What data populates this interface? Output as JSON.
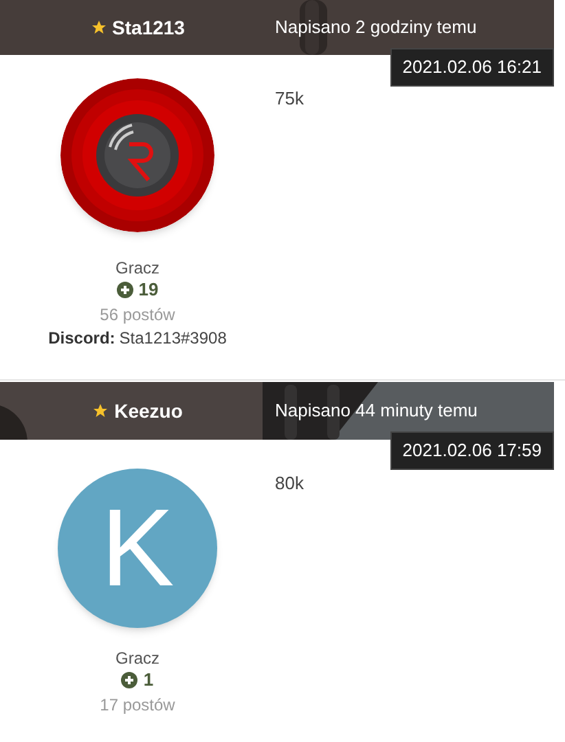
{
  "posts": [
    {
      "author": {
        "name": "Sta1213",
        "starred": true
      },
      "posted": "Napisano 2 godziny temu",
      "timestamp": "2021.02.06 16:21",
      "content": "75k",
      "avatar": {
        "kind": "picture"
      },
      "rank": "Gracz",
      "reputation": "19",
      "post_count": "56 postów",
      "fields": [
        {
          "label": "Discord:",
          "value": "Sta1213#3908"
        }
      ]
    },
    {
      "author": {
        "name": "Keezuo",
        "starred": true
      },
      "posted": "Napisano 44 minuty temu",
      "timestamp": "2021.02.06 17:59",
      "content": "80k",
      "avatar": {
        "kind": "letter",
        "letter": "K",
        "color": "#62a6c3"
      },
      "rank": "Gracz",
      "reputation": "1",
      "post_count": "17 postów"
    }
  ]
}
